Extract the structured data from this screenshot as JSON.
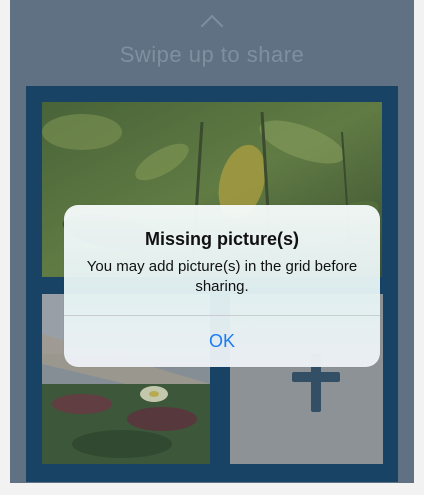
{
  "swipe": {
    "text": "Swipe up to share",
    "icon": "chevron-up-icon"
  },
  "grid": {
    "slots": [
      {
        "position": "top",
        "content": "photo-green-leaves"
      },
      {
        "position": "bottom-left",
        "content": "photo-ice-plants-coast"
      },
      {
        "position": "bottom-right",
        "content": "empty",
        "icon": "plus-icon"
      }
    ]
  },
  "alert": {
    "title": "Missing picture(s)",
    "message": "You may add picture(s) in the grid before sharing.",
    "ok_label": "OK"
  },
  "colors": {
    "accent": "#1a7cf5",
    "grid_background": "#0d3f66",
    "page_background": "#6b7d8c",
    "empty_slot": "#a9a9a9"
  }
}
